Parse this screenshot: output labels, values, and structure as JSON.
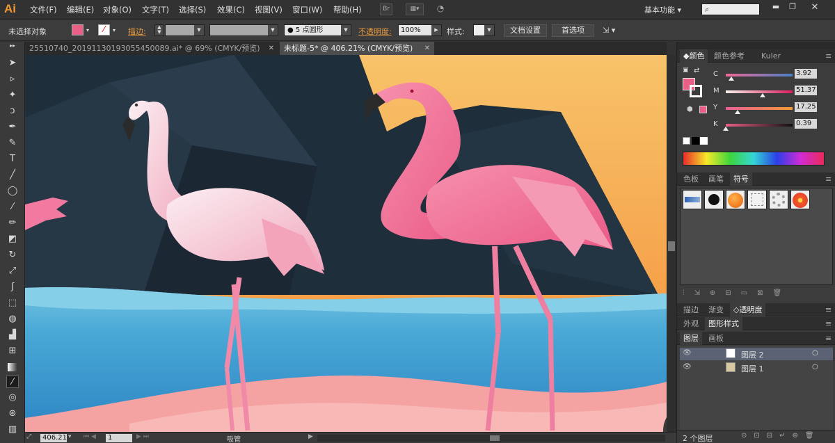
{
  "app": {
    "logo": "Ai"
  },
  "menu": [
    "文件(F)",
    "编辑(E)",
    "对象(O)",
    "文字(T)",
    "选择(S)",
    "效果(C)",
    "视图(V)",
    "窗口(W)",
    "帮助(H)"
  ],
  "menubar_icons": {
    "bridge": "Br",
    "arrange": "arrange-documents-icon",
    "gpu": "gpu-preview-icon"
  },
  "workspace": {
    "label": "基本功能"
  },
  "search": {
    "placeholder": ""
  },
  "control": {
    "selection": "未选择对象",
    "fill_color": "#e95f86",
    "stroke_label": "描边:",
    "brush_label": "5 点圆形",
    "opacity_label": "不透明度:",
    "opacity_value": "100%",
    "style_label": "样式:",
    "doc_setup": "文档设置",
    "prefs": "首选项"
  },
  "tabs": [
    {
      "label": "25510740_20191130193055450089.ai* @ 69% (CMYK/预览)",
      "active": false
    },
    {
      "label": "未标题-5* @ 406.21% (CMYK/预览)",
      "active": true
    }
  ],
  "tools": [
    "selection-tool",
    "direct-selection-tool",
    "magic-wand-tool",
    "lasso-tool",
    "pen-tool",
    "curvature-tool",
    "type-tool",
    "line-tool",
    "ellipse-tool",
    "paintbrush-tool",
    "pencil-tool",
    "eraser-tool",
    "rotate-tool",
    "scale-tool",
    "warp-tool",
    "free-transform-tool",
    "shape-builder-tool",
    "perspective-tool",
    "mesh-tool",
    "gradient-tool",
    "eyedropper-tool",
    "blend-tool",
    "symbol-sprayer-tool",
    "graph-tool"
  ],
  "color_panel": {
    "tabs": [
      "颜色",
      "颜色参考",
      "Kuler"
    ],
    "sliders": [
      {
        "label": "C",
        "value": "3.92",
        "pos": 0.04,
        "color": "#c96a8e"
      },
      {
        "label": "M",
        "value": "51.37",
        "pos": 0.51,
        "color": "#d6608c"
      },
      {
        "label": "Y",
        "value": "17.25",
        "pos": 0.17,
        "color": "#e08a6a"
      },
      {
        "label": "K",
        "value": "0.39",
        "pos": 0.0,
        "color": "#888"
      }
    ],
    "fill": "#e95f86"
  },
  "symbols_panel": {
    "tabs": [
      "色板",
      "画笔",
      "符号"
    ],
    "symbols": [
      "blue-banner-symbol",
      "ink-splat-symbol",
      "orange-button-symbol",
      "frame-symbol",
      "ring-symbol",
      "flower-symbol"
    ]
  },
  "transparency_tabs": [
    "描边",
    "渐变",
    "透明度"
  ],
  "appearance_tabs": [
    "外观",
    "图形样式"
  ],
  "layers_panel": {
    "tabs": [
      "图层",
      "画板"
    ],
    "layers": [
      {
        "name": "图层 2",
        "selected": true
      },
      {
        "name": "图层 1",
        "selected": false
      }
    ],
    "count": "2 个图层"
  },
  "status": {
    "zoom": "406.21",
    "artboard": "1",
    "tool": "吸管"
  }
}
